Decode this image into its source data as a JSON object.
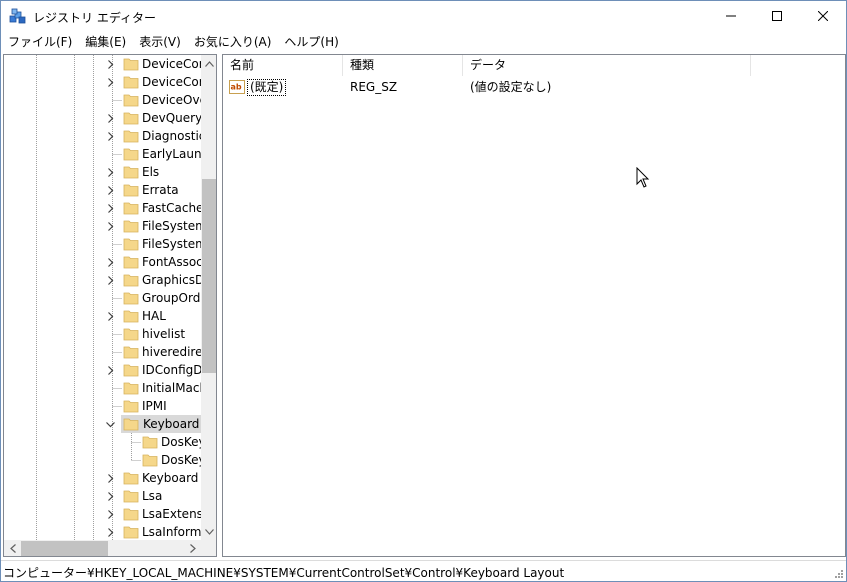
{
  "window": {
    "title": "レジストリ エディター",
    "icon": "registry-editor-icon"
  },
  "menu": {
    "items": [
      "ファイル(F)",
      "編集(E)",
      "表示(V)",
      "お気に入り(A)",
      "ヘルプ(H)"
    ]
  },
  "tree": {
    "items": [
      {
        "label": "DeviceContainers",
        "expander": "collapsed"
      },
      {
        "label": "DeviceContainerPropertyUpdateEvents",
        "expander": "collapsed"
      },
      {
        "label": "DeviceOverrides",
        "expander": "none"
      },
      {
        "label": "DevQuery",
        "expander": "collapsed"
      },
      {
        "label": "Diagnostics",
        "expander": "collapsed"
      },
      {
        "label": "EarlyLaunch",
        "expander": "none"
      },
      {
        "label": "Els",
        "expander": "collapsed"
      },
      {
        "label": "Errata",
        "expander": "collapsed"
      },
      {
        "label": "FastCache",
        "expander": "collapsed"
      },
      {
        "label": "FileSystem",
        "expander": "collapsed"
      },
      {
        "label": "FileSystemUtilities",
        "expander": "none"
      },
      {
        "label": "FontAssoc",
        "expander": "collapsed"
      },
      {
        "label": "GraphicsDrivers",
        "expander": "collapsed"
      },
      {
        "label": "GroupOrderList",
        "expander": "none"
      },
      {
        "label": "HAL",
        "expander": "collapsed"
      },
      {
        "label": "hivelist",
        "expander": "none"
      },
      {
        "label": "hiveredirectionlist",
        "expander": "none"
      },
      {
        "label": "IDConfigDB",
        "expander": "collapsed"
      },
      {
        "label": "InitialMachineConfig",
        "expander": "none"
      },
      {
        "label": "IPMI",
        "expander": "none"
      },
      {
        "label": "Keyboard Layout",
        "expander": "expanded",
        "selected": true
      },
      {
        "label": "DosKeybCodes",
        "expander": "none",
        "child": true
      },
      {
        "label": "DosKeybIDs",
        "expander": "none",
        "child": true
      },
      {
        "label": "Keyboard Layouts",
        "expander": "collapsed"
      },
      {
        "label": "Lsa",
        "expander": "collapsed"
      },
      {
        "label": "LsaExtensionConfig",
        "expander": "collapsed"
      },
      {
        "label": "LsaInformation",
        "expander": "collapsed"
      }
    ]
  },
  "list": {
    "columns": {
      "name": "名前",
      "type": "種類",
      "data": "データ"
    },
    "rows": [
      {
        "name": "(既定)",
        "type": "REG_SZ",
        "data": "(値の設定なし)",
        "icon": "string-value-icon"
      }
    ]
  },
  "status": {
    "path": "コンピューター¥HKEY_LOCAL_MACHINE¥SYSTEM¥CurrentControlSet¥Control¥Keyboard Layout"
  },
  "colors": {
    "folder": "#f5d78a",
    "selection": "#d9d9d9",
    "scrollbar": "#f0f0f0",
    "thumb": "#c2c2c2"
  }
}
